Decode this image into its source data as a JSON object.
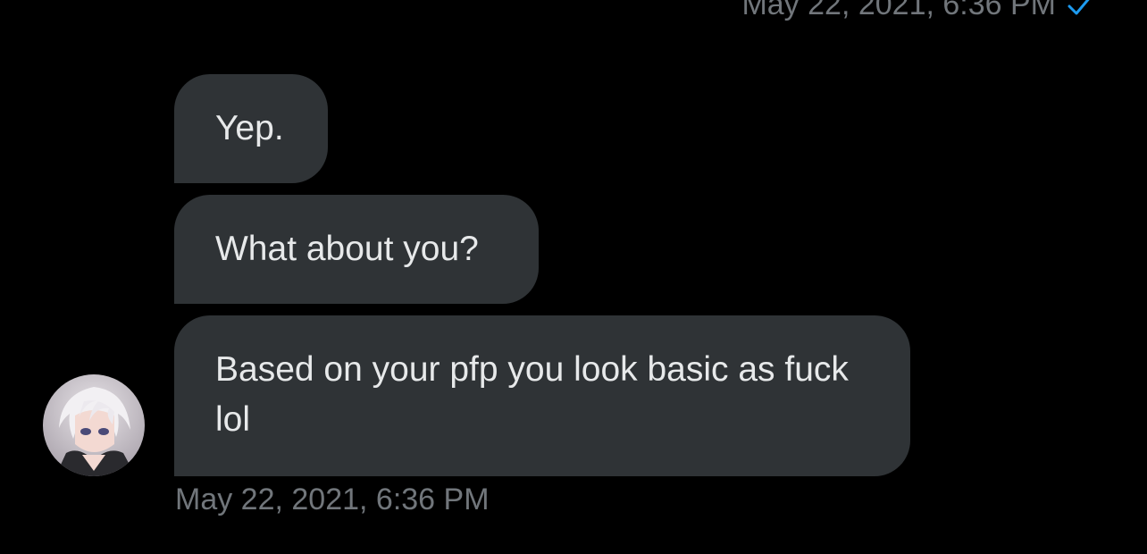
{
  "header": {
    "last_sent_timestamp": "May 22, 2021, 6:36 PM",
    "read_receipt_icon": "check-icon"
  },
  "messages": [
    {
      "text": "Yep."
    },
    {
      "text": "What about you?"
    },
    {
      "text": "Based on your pfp you look basic as fuck lol"
    }
  ],
  "received_group": {
    "timestamp": "May 22, 2021, 6:36 PM",
    "avatar_icon": "avatar"
  },
  "colors": {
    "background": "#000000",
    "bubble": "#2f3336",
    "text": "#e7e9ea",
    "muted": "#71767b",
    "accent": "#1d9bf0"
  }
}
